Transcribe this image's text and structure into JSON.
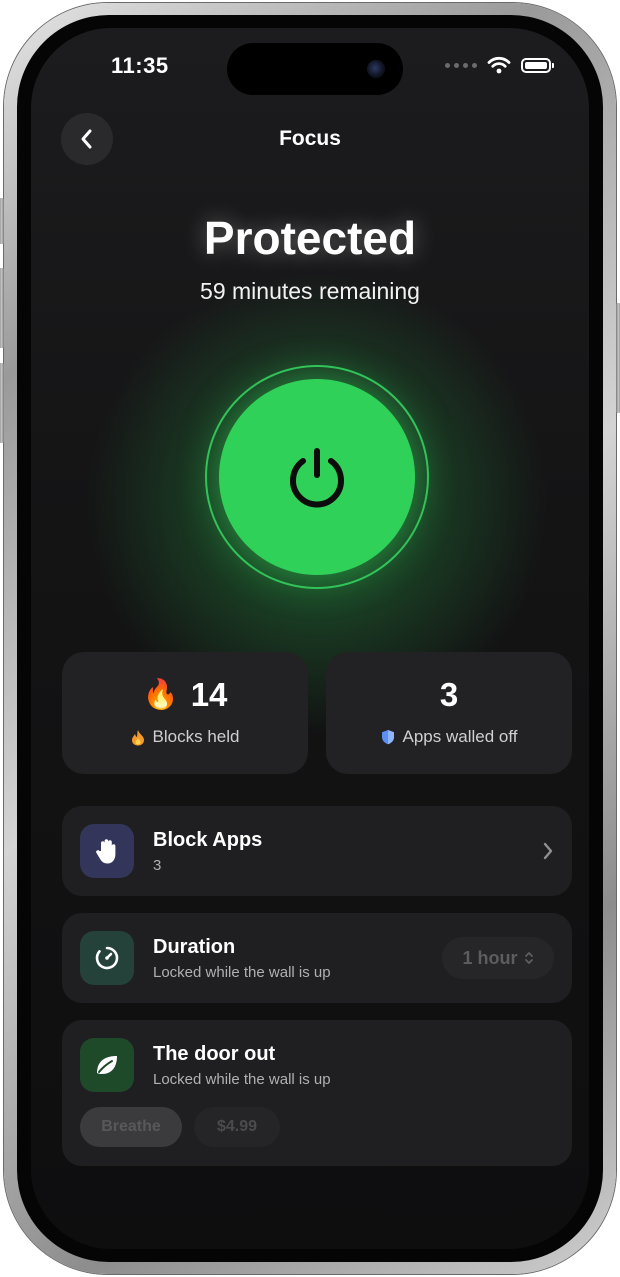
{
  "status_bar": {
    "time": "11:35",
    "wifi_icon": "wifi-icon",
    "battery_icon": "battery-icon"
  },
  "nav": {
    "title": "Focus",
    "back_icon": "chevron-left-icon"
  },
  "hero": {
    "title": "Protected",
    "subtitle": "59 minutes remaining",
    "power_icon": "power-icon",
    "accent_color": "#30d158"
  },
  "stats": [
    {
      "emoji": "🔥",
      "value": "14",
      "caption": "Blocks held",
      "caption_icon": "flame-icon"
    },
    {
      "value": "3",
      "caption": "Apps walled off",
      "caption_icon": "shield-icon"
    }
  ],
  "rows": {
    "block_apps": {
      "title": "Block Apps",
      "subtitle": "3",
      "icon": "hand-icon",
      "icon_bg": "#33365a"
    },
    "duration": {
      "title": "Duration",
      "subtitle": "Locked while the wall is up",
      "value": "1 hour",
      "icon": "timer-icon",
      "icon_bg": "#24413a"
    },
    "door_out": {
      "title": "The door out",
      "subtitle": "Locked while the wall is up",
      "icon": "leaf-icon",
      "icon_bg": "#1f4a2a",
      "actions": [
        "Breathe",
        "$4.99"
      ]
    }
  }
}
